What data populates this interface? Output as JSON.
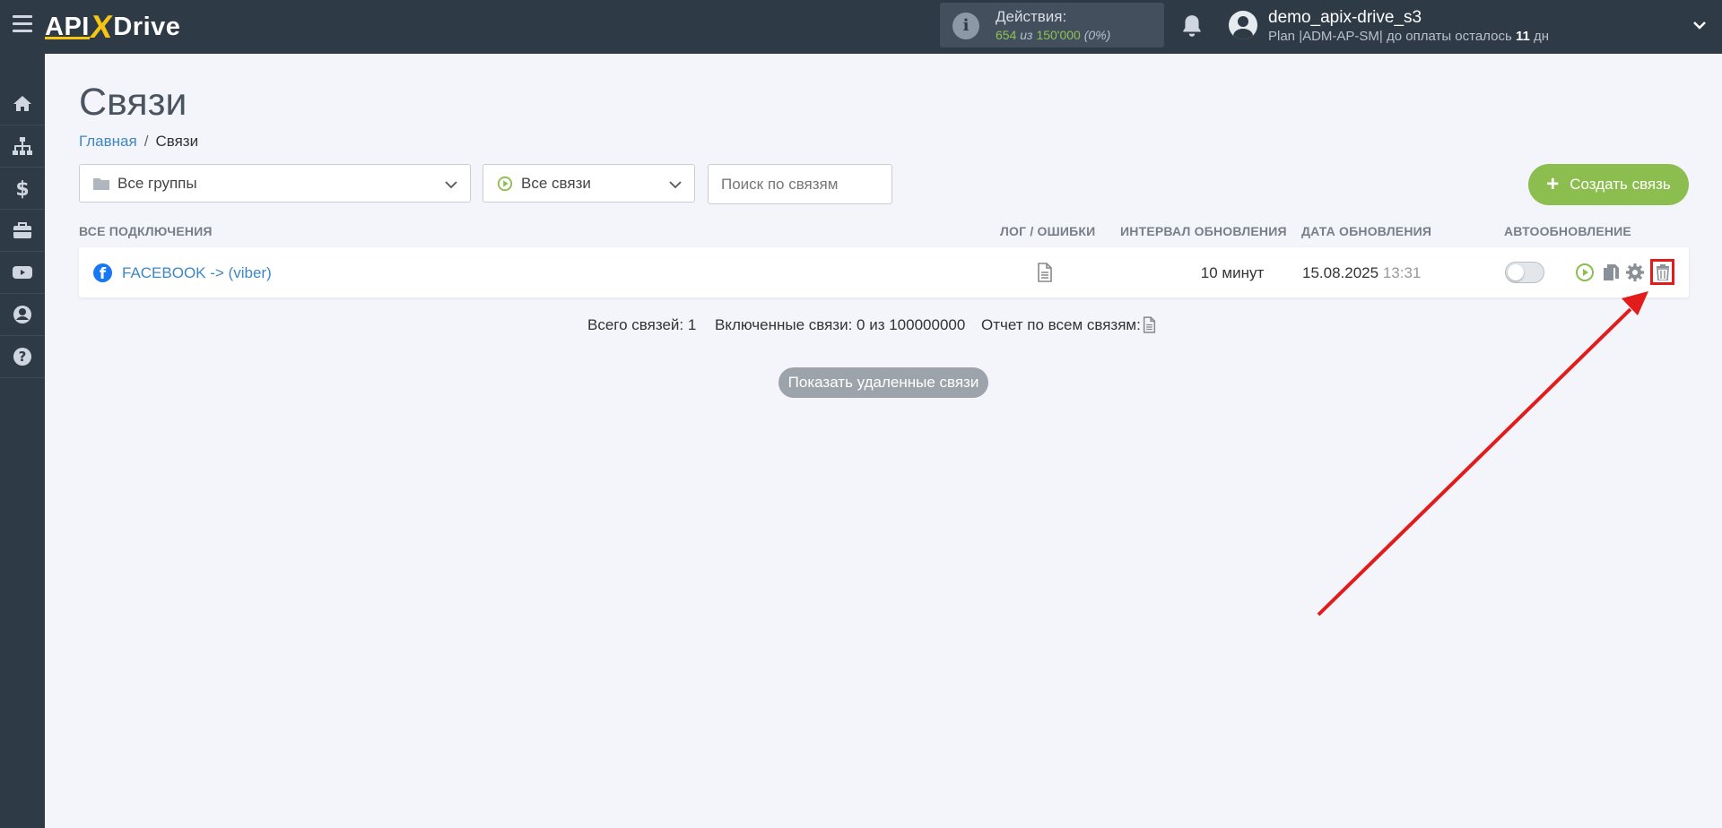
{
  "header": {
    "logo": {
      "api": "API",
      "x": "X",
      "drive": "Drive"
    },
    "actions": {
      "title": "Действия:",
      "used": "654",
      "of_word": "из",
      "total": "150'000",
      "percent": "(0%)"
    },
    "user": {
      "name": "demo_apix-drive_s3",
      "plan_prefix": "Plan |ADM-AP-SM| до оплаты осталось",
      "days": "11",
      "days_suffix": "дн"
    }
  },
  "sidebar": {
    "items": [
      "home-icon",
      "sitemap-icon",
      "dollar-icon",
      "briefcase-icon",
      "youtube-icon",
      "user-circle-icon",
      "help-icon"
    ]
  },
  "page": {
    "title": "Связи",
    "breadcrumb": {
      "home": "Главная",
      "separator": "/",
      "current": "Связи"
    }
  },
  "filters": {
    "groups": "Все группы",
    "status": "Все связи",
    "search_placeholder": "Поиск по связям",
    "create_label": "Создать связь",
    "create_plus": "+"
  },
  "table": {
    "headers": {
      "all": "ВСЕ ПОДКЛЮЧЕНИЯ",
      "log": "ЛОГ / ОШИБКИ",
      "interval": "ИНТЕРВАЛ ОБНОВЛЕНИЯ",
      "date": "ДАТА ОБНОВЛЕНИЯ",
      "auto": "АВТООБНОВЛЕНИЕ"
    },
    "rows": [
      {
        "name": "FACEBOOK -> (viber)",
        "interval": "10 минут",
        "date": "15.08.2025",
        "time": "13:31",
        "auto_update": false
      }
    ]
  },
  "summary": {
    "total": "Всего связей: 1",
    "enabled": "Включенные связи: 0 из 100000000",
    "report": "Отчет по всем связям:"
  },
  "show_deleted": "Показать удаленные связи",
  "colors": {
    "topbar": "#2f3a47",
    "accent_green": "#8cbd4f",
    "link_blue": "#3d87c5",
    "highlight_red": "#e21b1b"
  }
}
